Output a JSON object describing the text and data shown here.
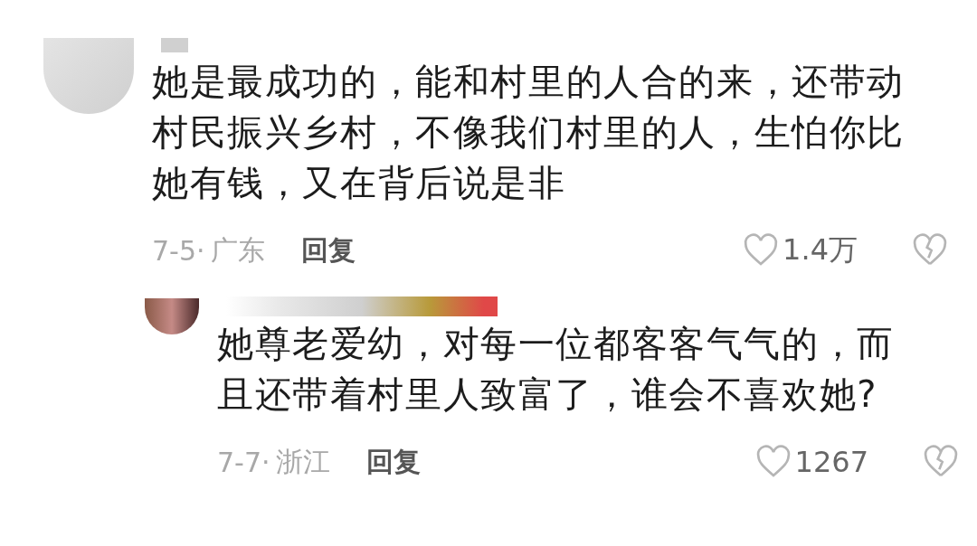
{
  "comments": [
    {
      "text": "她是最成功的，能和村里的人合的来，还带动村民振兴乡村，不像我们村里的人，生怕你比她有钱，又在背后说是非",
      "date": "7-5·",
      "location": "广东",
      "reply_label": "回复",
      "likes": "1.4万",
      "replies": [
        {
          "text": "她尊老爱幼，对每一位都客客气气的，而且还带着村里人致富了，谁会不喜欢她?",
          "date": "7-7·",
          "location": "浙江",
          "reply_label": "回复",
          "likes": "1267"
        }
      ]
    }
  ]
}
